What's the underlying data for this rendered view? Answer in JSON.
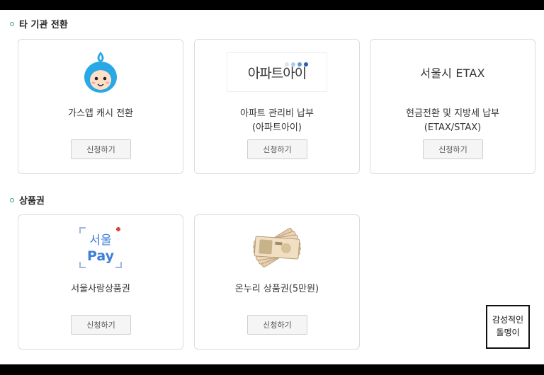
{
  "sections": [
    {
      "title": "타 기관 전환",
      "cards": [
        {
          "title": "가스앱 캐시 전환",
          "logo_icon": "gas-app-mascot-icon",
          "button": "신청하기"
        },
        {
          "title_line1": "아파트 관리비 납부",
          "title_line2": "(아파트아이)",
          "logo_text": "아파트아이",
          "button": "신청하기"
        },
        {
          "title_line1": "현금전환 및 지방세 납부",
          "title_line2": "(ETAX/STAX)",
          "logo_text": "서울시 ETAX",
          "button": "신청하기"
        }
      ]
    },
    {
      "title": "상품권",
      "cards": [
        {
          "title": "서울사랑상품권",
          "logo_line1": "서울",
          "logo_line2": "Pay",
          "button": "신청하기"
        },
        {
          "title": "온누리 상품권(5만원)",
          "logo_icon": "banknotes-icon",
          "button": "신청하기"
        }
      ]
    }
  ],
  "stamp": {
    "line1": "감성적인",
    "line2": "돌멩이"
  },
  "colors": {
    "bullet": "#2fa36b",
    "gas_mascot": "#2aa8e6",
    "seoul_pay": "#3d7fd6",
    "seoul_pay_plus": "#d9403a"
  }
}
